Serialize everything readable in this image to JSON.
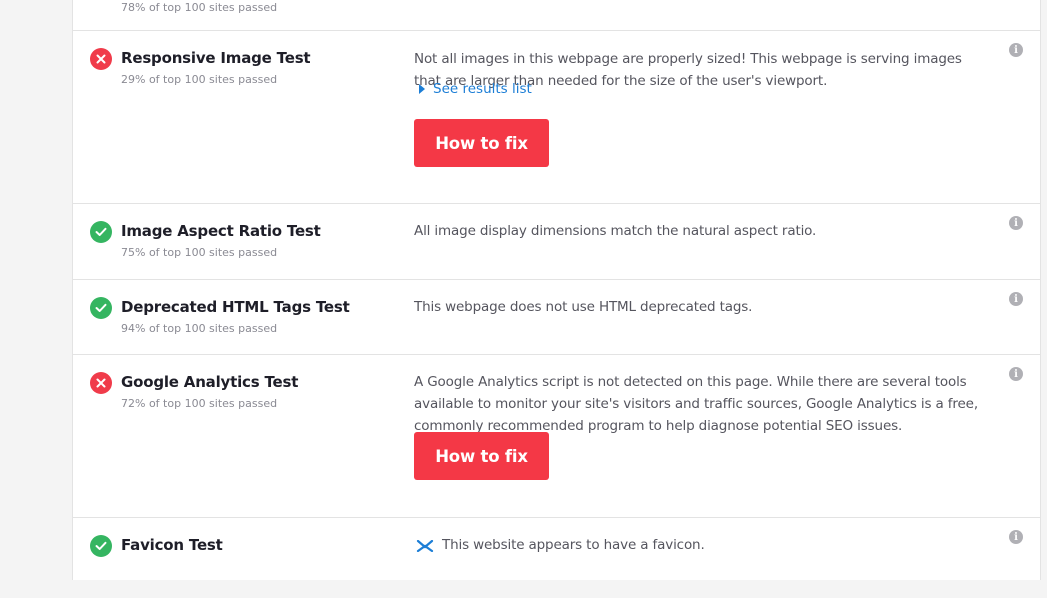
{
  "tests": [
    {
      "title": "",
      "sub": "78% of top 100 sites passed"
    },
    {
      "status": "fail",
      "title": "Responsive Image Test",
      "sub": "29% of top 100 sites passed",
      "description": "Not all images in this webpage are properly sized! This webpage is serving images that are larger than needed for the size of the user's viewport.",
      "toggle_label": "See results list",
      "fix_label": "How to fix"
    },
    {
      "status": "pass",
      "title": "Image Aspect Ratio Test",
      "sub": "75% of top 100 sites passed",
      "description": "All image display dimensions match the natural aspect ratio."
    },
    {
      "status": "pass",
      "title": "Deprecated HTML Tags Test",
      "sub": "94% of top 100 sites passed",
      "description": "This webpage does not use HTML deprecated tags."
    },
    {
      "status": "fail",
      "title": "Google Analytics Test",
      "sub": "72% of top 100 sites passed",
      "description": "A Google Analytics script is not detected on this page. While there are several tools available to monitor your site's visitors and traffic sources, Google Analytics is a free, commonly recommended program to help diagnose potential SEO issues.",
      "fix_label": "How to fix"
    },
    {
      "status": "pass",
      "title": "Favicon Test",
      "description": "This website appears to have a favicon."
    }
  ],
  "icons": {
    "fail": "close-icon",
    "pass": "checkmark-icon",
    "info": "info-icon",
    "info_glyph": "i"
  },
  "colors": {
    "fail": "#f03b4a",
    "pass": "#35b561",
    "button": "#f43846",
    "link": "#1c7ed6"
  }
}
